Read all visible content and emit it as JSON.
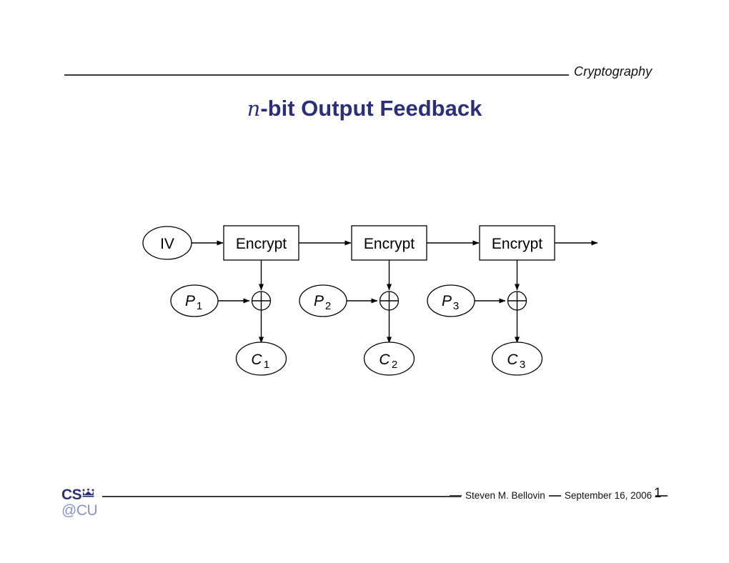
{
  "header": {
    "course": "Cryptography",
    "rule_icon": "horizontal-rule"
  },
  "title": {
    "math_prefix": "n",
    "rest": "-bit Output Feedback",
    "color": "#2b2f7a"
  },
  "diagram": {
    "name": "n-bit-output-feedback-mode-diagram",
    "iv_label": "IV",
    "blocks": [
      {
        "cipher_label": "Encrypt",
        "plaintext_base": "P",
        "plaintext_sub": "1",
        "ciphertext_base": "C",
        "ciphertext_sub": "1",
        "xor_symbol": "xor"
      },
      {
        "cipher_label": "Encrypt",
        "plaintext_base": "P",
        "plaintext_sub": "2",
        "ciphertext_base": "C",
        "ciphertext_sub": "2",
        "xor_symbol": "xor"
      },
      {
        "cipher_label": "Encrypt",
        "plaintext_base": "P",
        "plaintext_sub": "3",
        "ciphertext_base": "C",
        "ciphertext_sub": "3",
        "xor_symbol": "xor"
      }
    ]
  },
  "footer": {
    "logo_top": "CS",
    "logo_crown": "crown-icon",
    "logo_bottom": "@CU",
    "author": "Steven M. Bellovin",
    "date": "September 16, 2006",
    "page_number": "1"
  }
}
